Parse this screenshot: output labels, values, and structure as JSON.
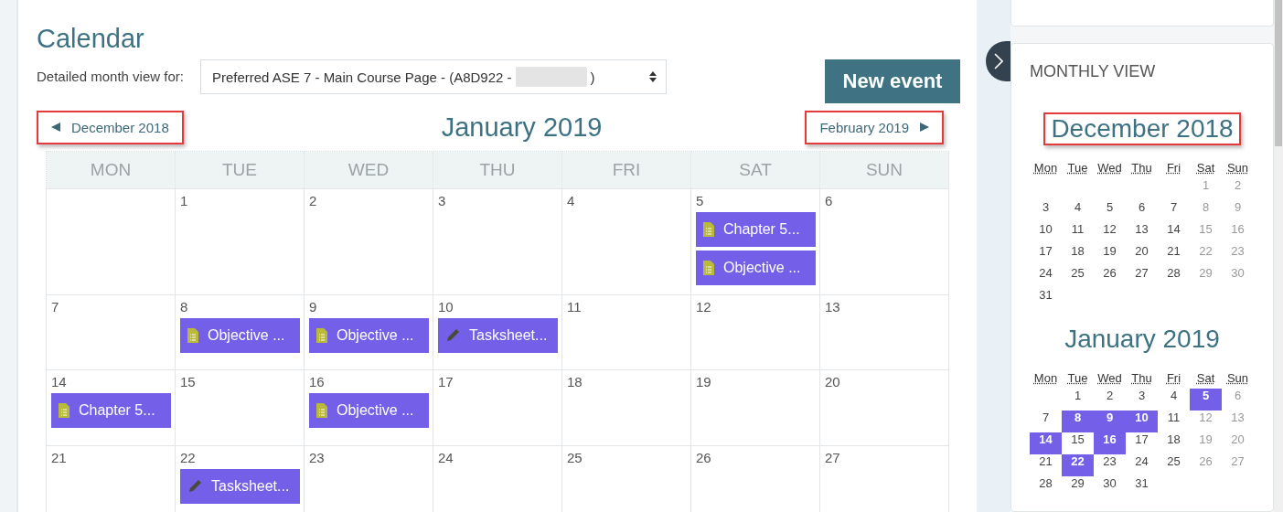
{
  "main": {
    "title": "Calendar",
    "filter_label": "Detailed month view for:",
    "course_select": {
      "value": "Preferred ASE 7 - Main Course Page - (A8D922 -",
      "value_end": ")"
    },
    "new_event_button": "New event",
    "prev_month": {
      "label": "December 2018",
      "annotated": true
    },
    "month_title": "January 2019",
    "next_month": {
      "label": "February 2019",
      "annotated": true
    },
    "weekdays": [
      "MON",
      "TUE",
      "WED",
      "THU",
      "FRI",
      "SAT",
      "SUN"
    ],
    "first_week_right_aligned": true,
    "weeks": [
      [
        {
          "day": "1"
        },
        {
          "day": "2"
        },
        {
          "day": "3"
        },
        {
          "day": "4"
        },
        {
          "day": "5",
          "events": [
            {
              "kind": "document",
              "title": "Chapter 5..."
            },
            {
              "kind": "document",
              "title": "Objective ..."
            }
          ]
        },
        {
          "day": "6"
        }
      ],
      [
        {
          "day": "7"
        },
        {
          "day": "8",
          "events": [
            {
              "kind": "document",
              "title": "Objective ..."
            }
          ]
        },
        {
          "day": "9",
          "events": [
            {
              "kind": "document",
              "title": "Objective ..."
            }
          ]
        },
        {
          "day": "10",
          "events": [
            {
              "kind": "pencil",
              "title": "Tasksheet..."
            }
          ]
        },
        {
          "day": "11"
        },
        {
          "day": "12"
        },
        {
          "day": "13"
        }
      ],
      [
        {
          "day": "14",
          "events": [
            {
              "kind": "document",
              "title": "Chapter 5..."
            }
          ]
        },
        {
          "day": "15"
        },
        {
          "day": "16",
          "events": [
            {
              "kind": "document",
              "title": "Objective ..."
            }
          ]
        },
        {
          "day": "17"
        },
        {
          "day": "18"
        },
        {
          "day": "19"
        },
        {
          "day": "20"
        }
      ],
      [
        {
          "day": "21"
        },
        {
          "day": "22",
          "events": [
            {
              "kind": "pencil",
              "title": "Tasksheet..."
            }
          ]
        },
        {
          "day": "23"
        },
        {
          "day": "24"
        },
        {
          "day": "25"
        },
        {
          "day": "26"
        },
        {
          "day": "27"
        }
      ]
    ]
  },
  "sidebar": {
    "block_title": "MONTHLY VIEW",
    "months": [
      {
        "title": "December 2018",
        "annotated": true,
        "weekdays": [
          "Mon",
          "Tue",
          "Wed",
          "Thu",
          "Fri",
          "Sat",
          "Sun"
        ],
        "first_week_right_aligned": true,
        "weeks": [
          [
            {
              "day": "1",
              "event": false
            },
            {
              "day": "2",
              "event": false
            }
          ],
          [
            {
              "day": "3",
              "event": false
            },
            {
              "day": "4",
              "event": false
            },
            {
              "day": "5",
              "event": false
            },
            {
              "day": "6",
              "event": false
            },
            {
              "day": "7",
              "event": false
            },
            {
              "day": "8",
              "event": false
            },
            {
              "day": "9",
              "event": false
            }
          ],
          [
            {
              "day": "10",
              "event": false
            },
            {
              "day": "11",
              "event": false
            },
            {
              "day": "12",
              "event": false
            },
            {
              "day": "13",
              "event": false
            },
            {
              "day": "14",
              "event": false
            },
            {
              "day": "15",
              "event": false
            },
            {
              "day": "16",
              "event": false
            }
          ],
          [
            {
              "day": "17",
              "event": false
            },
            {
              "day": "18",
              "event": false
            },
            {
              "day": "19",
              "event": false
            },
            {
              "day": "20",
              "event": false
            },
            {
              "day": "21",
              "event": false
            },
            {
              "day": "22",
              "event": false
            },
            {
              "day": "23",
              "event": false
            }
          ],
          [
            {
              "day": "24",
              "event": false
            },
            {
              "day": "25",
              "event": false
            },
            {
              "day": "26",
              "event": false
            },
            {
              "day": "27",
              "event": false
            },
            {
              "day": "28",
              "event": false
            },
            {
              "day": "29",
              "event": false
            },
            {
              "day": "30",
              "event": false
            }
          ],
          [
            {
              "day": "31",
              "event": false
            }
          ]
        ]
      },
      {
        "title": "January 2019",
        "annotated": false,
        "weekdays": [
          "Mon",
          "Tue",
          "Wed",
          "Thu",
          "Fri",
          "Sat",
          "Sun"
        ],
        "first_week_right_aligned": true,
        "weeks": [
          [
            {
              "day": "1",
              "event": false
            },
            {
              "day": "2",
              "event": false
            },
            {
              "day": "3",
              "event": false
            },
            {
              "day": "4",
              "event": false
            },
            {
              "day": "5",
              "event": true
            },
            {
              "day": "6",
              "event": false
            }
          ],
          [
            {
              "day": "7",
              "event": false
            },
            {
              "day": "8",
              "event": true
            },
            {
              "day": "9",
              "event": true
            },
            {
              "day": "10",
              "event": true
            },
            {
              "day": "11",
              "event": false
            },
            {
              "day": "12",
              "event": false
            },
            {
              "day": "13",
              "event": false
            }
          ],
          [
            {
              "day": "14",
              "event": true
            },
            {
              "day": "15",
              "event": false
            },
            {
              "day": "16",
              "event": true
            },
            {
              "day": "17",
              "event": false
            },
            {
              "day": "18",
              "event": false
            },
            {
              "day": "19",
              "event": false
            },
            {
              "day": "20",
              "event": false
            }
          ],
          [
            {
              "day": "21",
              "event": false
            },
            {
              "day": "22",
              "event": true
            },
            {
              "day": "23",
              "event": false
            },
            {
              "day": "24",
              "event": false
            },
            {
              "day": "25",
              "event": false
            },
            {
              "day": "26",
              "event": false
            },
            {
              "day": "27",
              "event": false
            }
          ],
          [
            {
              "day": "28",
              "event": false
            },
            {
              "day": "29",
              "event": false
            },
            {
              "day": "30",
              "event": false
            },
            {
              "day": "31",
              "event": false
            }
          ]
        ]
      }
    ]
  }
}
